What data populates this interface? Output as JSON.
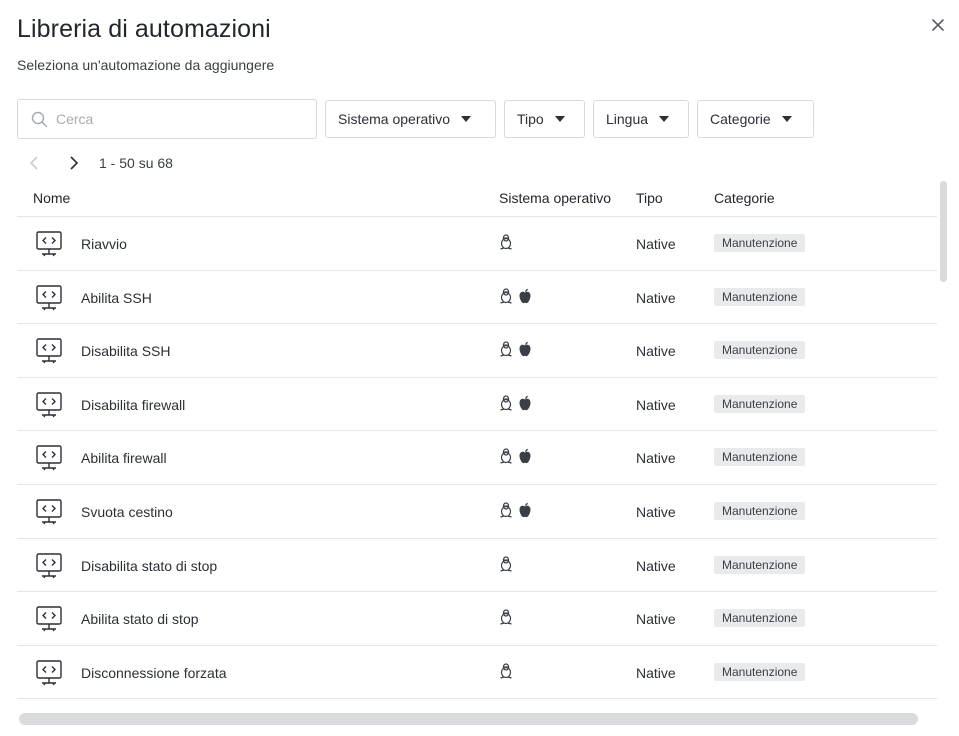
{
  "dialog": {
    "title": "Libreria di automazioni",
    "subtitle": "Seleziona un'automazione da aggiungere"
  },
  "search": {
    "placeholder": "Cerca",
    "value": ""
  },
  "filters": [
    {
      "label": "Sistema operativo"
    },
    {
      "label": "Tipo"
    },
    {
      "label": "Lingua"
    },
    {
      "label": "Categorie"
    }
  ],
  "pagination": {
    "range": "1 - 50 su 68"
  },
  "table": {
    "columns": [
      "Nome",
      "Sistema operativo",
      "Tipo",
      "Categorie"
    ],
    "rows": [
      {
        "name": "Riavvio",
        "os": [
          "linux-icon"
        ],
        "type": "Native",
        "category": "Manutenzione"
      },
      {
        "name": "Abilita SSH",
        "os": [
          "linux-icon",
          "apple-icon"
        ],
        "type": "Native",
        "category": "Manutenzione"
      },
      {
        "name": "Disabilita SSH",
        "os": [
          "linux-icon",
          "apple-icon"
        ],
        "type": "Native",
        "category": "Manutenzione"
      },
      {
        "name": "Disabilita firewall",
        "os": [
          "linux-icon",
          "apple-icon"
        ],
        "type": "Native",
        "category": "Manutenzione"
      },
      {
        "name": "Abilita firewall",
        "os": [
          "linux-icon",
          "apple-icon"
        ],
        "type": "Native",
        "category": "Manutenzione"
      },
      {
        "name": "Svuota cestino",
        "os": [
          "linux-icon",
          "apple-icon"
        ],
        "type": "Native",
        "category": "Manutenzione"
      },
      {
        "name": "Disabilita stato di stop",
        "os": [
          "linux-icon"
        ],
        "type": "Native",
        "category": "Manutenzione"
      },
      {
        "name": "Abilita stato di stop",
        "os": [
          "linux-icon"
        ],
        "type": "Native",
        "category": "Manutenzione"
      },
      {
        "name": "Disconnessione forzata",
        "os": [
          "linux-icon"
        ],
        "type": "Native",
        "category": "Manutenzione"
      }
    ]
  },
  "colors": {
    "text": "#2b2f36",
    "border": "#d6d9de",
    "tag_bg": "#e9eaec",
    "scrollbar": "#d9dbdf"
  }
}
